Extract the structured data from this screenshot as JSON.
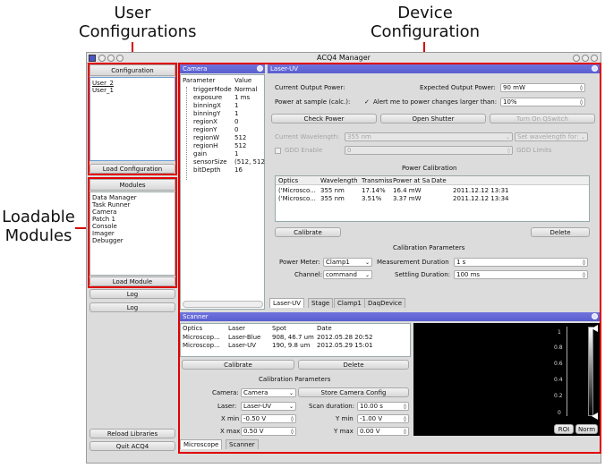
{
  "annotations": {
    "user_configurations": "User Configurations",
    "device_configuration": "Device Configuration",
    "loadable_modules": "Loadable Modules"
  },
  "window": {
    "title": "ACQ4 Manager"
  },
  "left": {
    "configuration_header": "Configuration",
    "configurations": [
      "User_2",
      "User_1"
    ],
    "load_configuration": "Load Configuration",
    "modules_header": "Modules",
    "modules": [
      "Data Manager",
      "Task Runner",
      "Camera",
      "Patch 1",
      "Console",
      "Imager",
      "Debugger"
    ],
    "load_module": "Load Module",
    "log1": "Log",
    "log2": "Log",
    "reload_libraries": "Reload Libraries",
    "quit": "Quit ACQ4"
  },
  "camera": {
    "title": "Camera",
    "col_param": "Parameter",
    "col_value": "Value",
    "params": [
      {
        "name": "triggerMode",
        "value": "Normal"
      },
      {
        "name": "exposure",
        "value": "1 ms"
      },
      {
        "name": "binningX",
        "value": "1"
      },
      {
        "name": "binningY",
        "value": "1"
      },
      {
        "name": "regionX",
        "value": "0"
      },
      {
        "name": "regionY",
        "value": "0"
      },
      {
        "name": "regionW",
        "value": "512"
      },
      {
        "name": "regionH",
        "value": "512"
      },
      {
        "name": "gain",
        "value": "1"
      },
      {
        "name": "sensorSize",
        "value": "(512, 512"
      },
      {
        "name": "bitDepth",
        "value": "16"
      }
    ]
  },
  "laser": {
    "title": "Laser-UV",
    "current_output_label": "Current Output Power:",
    "expected_output_label": "Expected Output Power:",
    "expected_output_value": "90 mW",
    "power_at_sample_label": "Power at sample (calc.):",
    "alert_label": "Alert me to power changes larger than:",
    "alert_value": "10%",
    "check_power": "Check Power",
    "open_shutter": "Open Shutter",
    "turn_on_qswitch": "Turn On QSwitch",
    "current_wavelength_label": "Current Wavelength:",
    "current_wavelength_value": "355 nm",
    "set_wavelength": "Set wavelength for:",
    "gdd_enable": "GDD Enable",
    "gdd_value": "0",
    "gdd_limits": "GDD Limits",
    "power_calibration": "Power Calibration",
    "cal_columns": [
      "Optics",
      "Wavelength",
      "Transmission",
      "Power at Sample",
      "Date"
    ],
    "cal_rows": [
      [
        "('Microsco...",
        "355 nm",
        "17.14%",
        "16.4 mW",
        "2011.12.12 13:31"
      ],
      [
        "('Microsco...",
        "355 nm",
        "3.51%",
        "3.37 mW",
        "2011.12.12 13:34"
      ]
    ],
    "calibrate": "Calibrate",
    "delete": "Delete",
    "cal_params_header": "Calibration Parameters",
    "power_meter_label": "Power Meter:",
    "power_meter_value": "Clamp1",
    "measurement_duration_label": "Measurement Duration",
    "measurement_duration_value": "1 s",
    "channel_label": "Channel:",
    "channel_value": "command",
    "settling_duration_label": "Settling Duration:",
    "settling_duration_value": "100 ms",
    "tabs": [
      "Laser-UV",
      "Stage",
      "Clamp1",
      "DaqDevice"
    ]
  },
  "scanner": {
    "title": "Scanner",
    "columns": [
      "Optics",
      "Laser",
      "Spot",
      "Date"
    ],
    "rows": [
      [
        "Microscop...",
        "Laser-Blue",
        "908, 46.7 um",
        "2012.05.28 20:52"
      ],
      [
        "Microscop...",
        "Laser-UV",
        "190, 9.8 um",
        "2012.05.29 15:01"
      ]
    ],
    "calibrate": "Calibrate",
    "delete": "Delete",
    "cal_params_header": "Calibration Parameters",
    "camera_label": "Camera:",
    "camera_value": "Camera",
    "store_camera_config": "Store Camera Config",
    "laser_label": "Laser:",
    "laser_value": "Laser-UV",
    "scan_duration_label": "Scan duration:",
    "scan_duration_value": "10.00 s",
    "xmin_label": "X min",
    "xmin_value": "-0.50 V",
    "ymin_label": "Y min",
    "ymin_value": "-1.00 V",
    "xmax_label": "X max",
    "xmax_value": "0.50 V",
    "ymax_label": "Y max",
    "ymax_value": "0.00 V",
    "histogram_ticks": [
      "1",
      "0.8",
      "0.6",
      "0.4",
      "0.2",
      "0"
    ],
    "roi": "ROI",
    "norm": "Norm",
    "tabs": [
      "Microscope",
      "Scanner"
    ]
  }
}
